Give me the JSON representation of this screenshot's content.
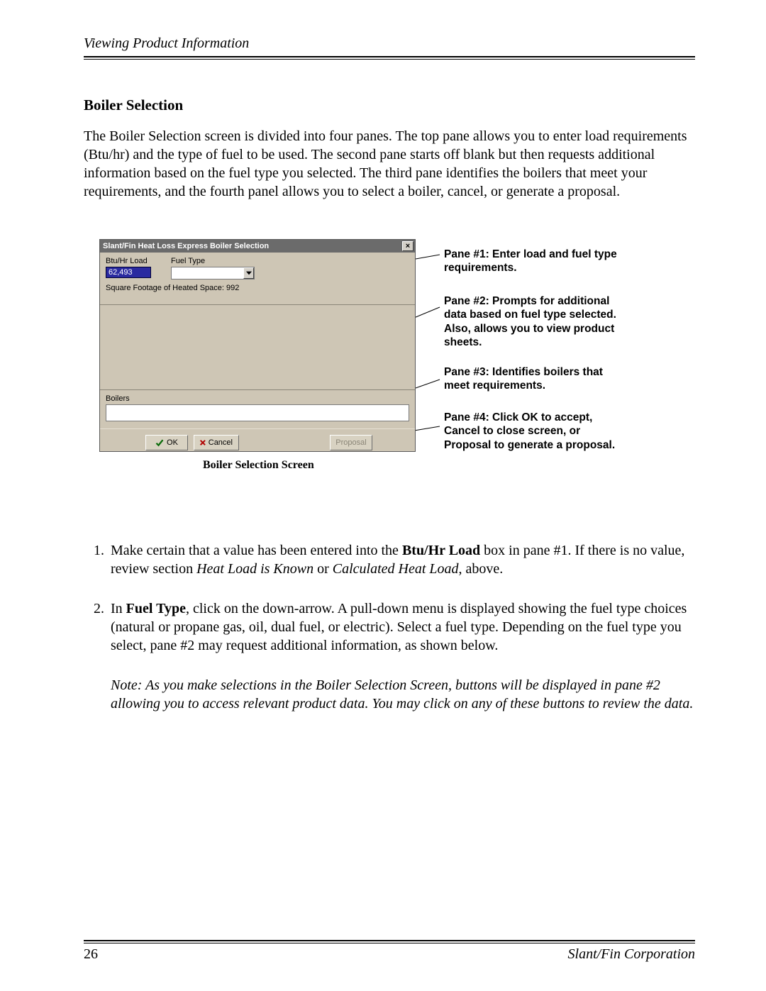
{
  "header": {
    "title": "Viewing Product Information"
  },
  "section": {
    "heading": "Boiler Selection",
    "intro": "The Boiler Selection screen is divided into four panes. The top pane allows you to enter load requirements (Btu/hr) and the type of fuel to be used. The second pane starts off blank but then requests additional information based on the fuel type you selected. The third pane identifies the boilers that meet your requirements, and the fourth panel allows you to select a boiler, cancel, or generate a proposal."
  },
  "dialog": {
    "title": "Slant/Fin Heat Loss Express Boiler Selection",
    "btu_label": "Btu/Hr Load",
    "btu_value": "62,493",
    "fuel_label": "Fuel Type",
    "sqft": "Square Footage of Heated Space: 992",
    "boilers_label": "Boilers",
    "ok": "OK",
    "cancel": "Cancel",
    "proposal": "Proposal"
  },
  "caption": "Boiler Selection Screen",
  "annotations": {
    "p1": "Pane #1: Enter load and fuel type requirements.",
    "p2": "Pane #2: Prompts for additional data based on fuel type selected. Also, allows you to view product sheets.",
    "p3": "Pane #3: Identifies boilers that meet requirements.",
    "p4": "Pane #4: Click OK to accept, Cancel to close screen, or Proposal to generate a proposal."
  },
  "steps": {
    "s1_a": "Make certain that a value has been entered into the ",
    "s1_b": "Btu/Hr Load",
    "s1_c": " box in pane #1. If there is no value, review section ",
    "s1_d": "Heat Load is Known",
    "s1_e": " or ",
    "s1_f": "Calculated Heat Load",
    "s1_g": ", above.",
    "s2_a": "In ",
    "s2_b": "Fuel Type",
    "s2_c": ", click on the down-arrow. A pull-down menu is displayed showing the fuel type choices (natural or propane gas, oil, dual fuel, or electric). Select a fuel type. Depending on the fuel type you select, pane #2 may request additional information, as shown below.",
    "note": "Note: As you make selections in the Boiler Selection Screen, buttons will be displayed in pane #2 allowing you to access relevant product data. You may click on any of these buttons to review the data."
  },
  "footer": {
    "page": "26",
    "corp": "Slant/Fin Corporation"
  }
}
